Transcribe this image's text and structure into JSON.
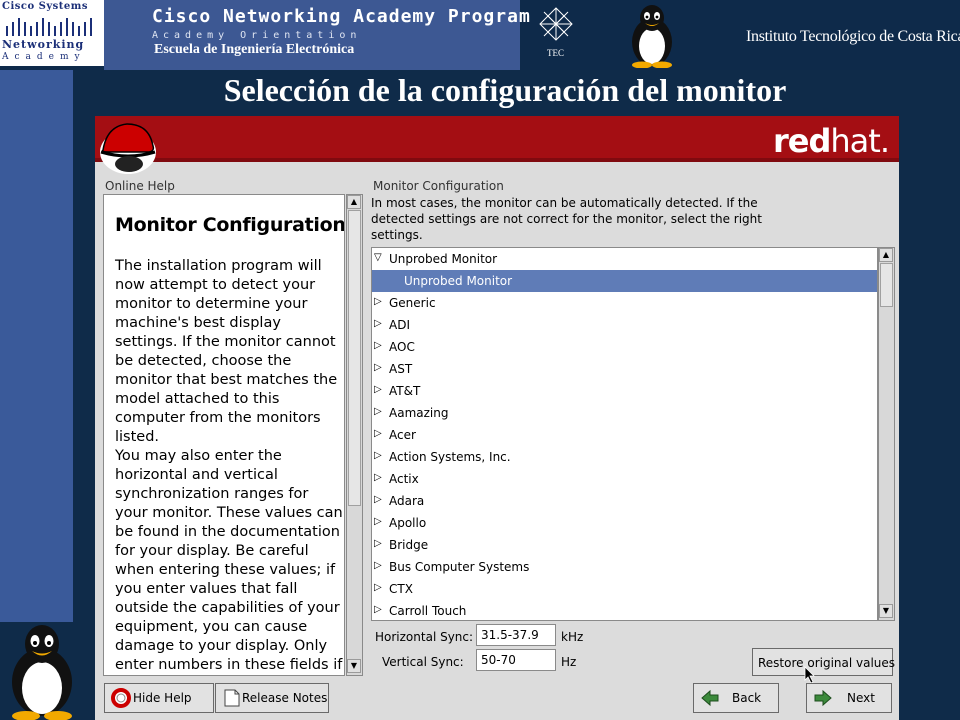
{
  "slide": {
    "cisco_line1": "Cisco Systems",
    "cisco_line2": "Networking",
    "cisco_line3": "Academy",
    "program_title": "Cisco Networking Academy Program",
    "program_subtitle": "Academy Orientation",
    "school": "Escuela de Ingeniería Electrónica",
    "tec_label": "TEC",
    "institute": "Instituto Tecnológico de Costa Rica",
    "title": "Selección de la configuración del monitor"
  },
  "installer": {
    "brand": {
      "bold": "red",
      "rest": "hat."
    },
    "online_help_label": "Online Help",
    "help": {
      "title": "Monitor Configuration",
      "p1": "The installation program will now attempt to detect your monitor to determine your machine's best display settings. If the monitor cannot be detected, choose the monitor that best matches the model attached to this computer from the monitors listed.",
      "p2": "You may also enter the horizontal and vertical synchronization ranges for your monitor. These values can be found in the documentation for your display. Be careful when entering these values; if you enter values that fall outside the capabilities of your equipment, you can cause damage to your display. Only enter numbers in these fields if the values in your"
    },
    "monitor_config_label": "Monitor Configuration",
    "description": "In most cases, the monitor can be automatically detected. If the detected settings are not correct for the monitor, select the right settings.",
    "tree": [
      {
        "label": "Unprobed Monitor",
        "expanded": true
      },
      {
        "label": "Unprobed Monitor",
        "child": true,
        "selected": true
      },
      {
        "label": "Generic"
      },
      {
        "label": "ADI"
      },
      {
        "label": "AOC"
      },
      {
        "label": "AST"
      },
      {
        "label": "AT&T"
      },
      {
        "label": "Aamazing"
      },
      {
        "label": "Acer"
      },
      {
        "label": "Action Systems, Inc."
      },
      {
        "label": "Actix"
      },
      {
        "label": "Adara"
      },
      {
        "label": "Apollo"
      },
      {
        "label": "Bridge"
      },
      {
        "label": "Bus Computer Systems"
      },
      {
        "label": "CTX"
      },
      {
        "label": "Carroll Touch"
      }
    ],
    "hsync": {
      "label": "Horizontal Sync:",
      "value": "31.5-37.9",
      "unit": "kHz"
    },
    "vsync": {
      "label": "Vertical Sync:",
      "value": "50-70",
      "unit": "Hz"
    },
    "buttons": {
      "restore": "Restore original values",
      "hide_help": "Hide Help",
      "release_notes": "Release Notes",
      "back": "Back",
      "next": "Next"
    }
  },
  "colors": {
    "redhat_banner": "#a40e13",
    "selection": "#5f7cb7",
    "slide_bg": "#0f2b49"
  }
}
